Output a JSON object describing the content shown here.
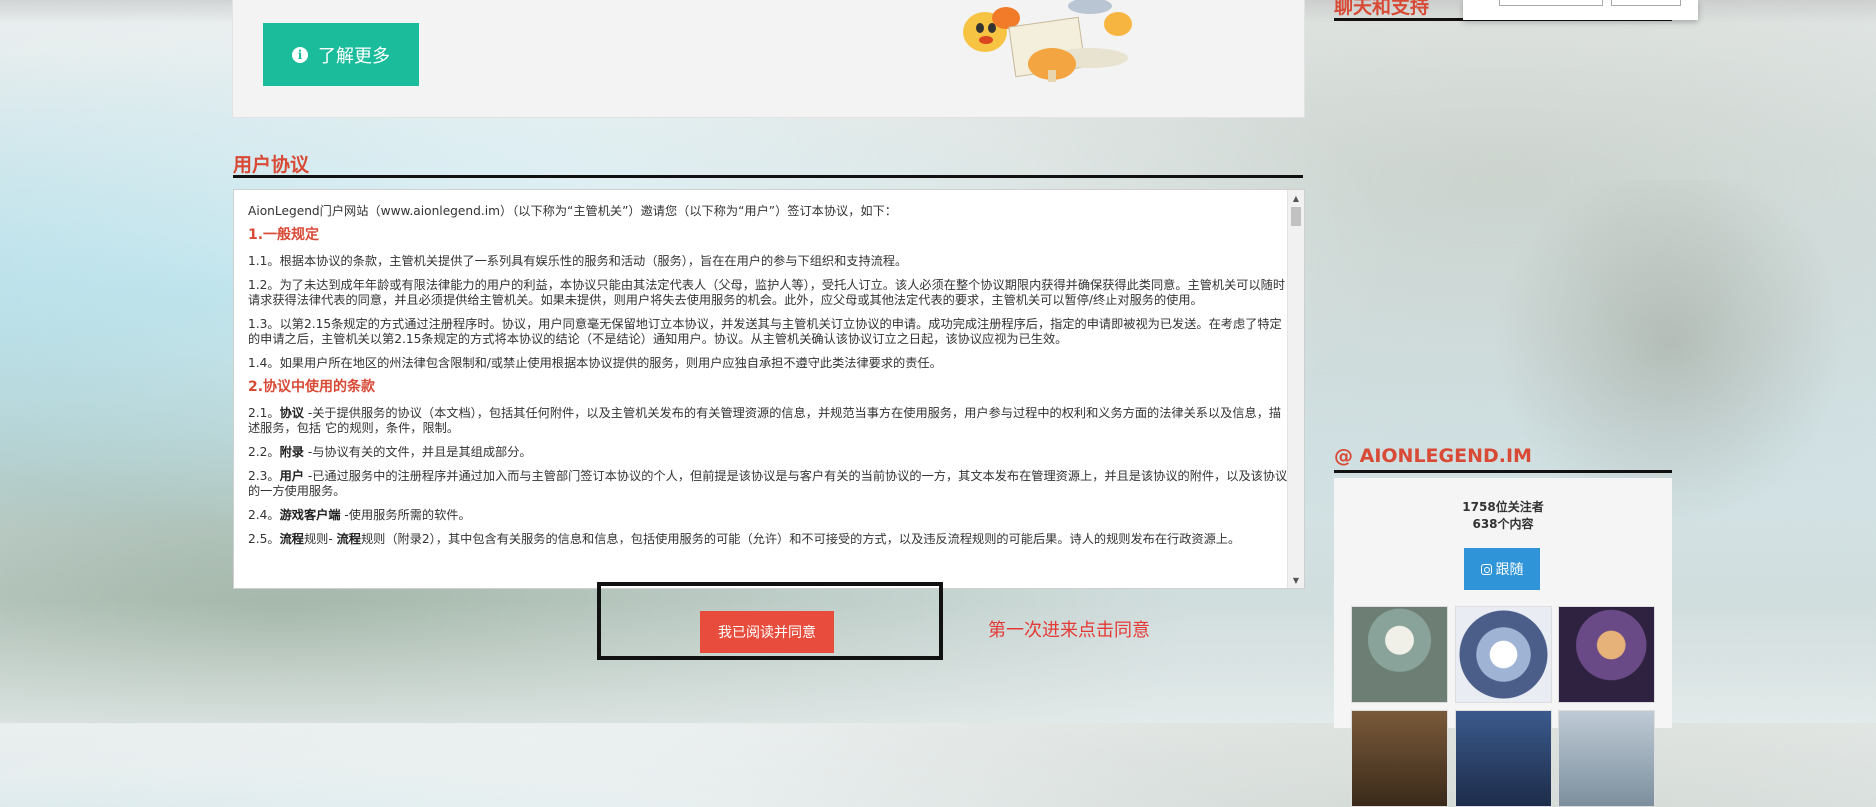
{
  "info_box": {
    "more_button_label": "了解更多"
  },
  "agreement": {
    "title": "用户协议",
    "intro": "AionLegend门户网站（www.aionlegend.im）（以下称为“主管机关”）邀请您（以下称为“用户”）签订本协议，如下：",
    "section1_heading": "1.一般规定",
    "s1_1": "1.1。根据本协议的条款，主管机关提供了一系列具有娱乐性的服务和活动（服务），旨在在用户的参与下组织和支持流程。",
    "s1_2": "1.2。为了未达到成年年龄或有限法律能力的用户的利益，本协议只能由其法定代表人（父母，监护人等），受托人订立。该人必须在整个协议期限内获得并确保获得此类同意。主管机关可以随时请求获得法律代表的同意，并且必须提供给主管机关。如果未提供，则用户将失去使用服务的机会。此外，应父母或其他法定代表的要求，主管机关可以暂停/终止对服务的使用。",
    "s1_3": "1.3。以第2.15条规定的方式通过注册程序时。协议，用户同意毫无保留地订立本协议，并发送其与主管机关订立协议的申请。成功完成注册程序后，指定的申请即被视为已发送。在考虑了特定的申请之后，主管机关以第2.15条规定的方式将本协议的结论（不是结论）通知用户。协议。从主管机关确认该协议订立之日起，该协议应视为已生效。",
    "s1_4": "1.4。如果用户所在地区的州法律包含限制和/或禁止使用根据本协议提供的服务，则用户应独自承担不遵守此类法律要求的责任。",
    "section2_heading": "2.协议中使用的条款",
    "s2_1_num": "2.1。",
    "s2_1_term": "协议",
    "s2_1_text": " -关于提供服务的协议（本文档），包括其任何附件，以及主管机关发布的有关管理资源的信息，并规范当事方在使用服务，用户参与过程中的权利和义务方面的法律关系以及信息，描述服务，包括 它的规则，条件，限制。",
    "s2_2_num": "2.2。",
    "s2_2_term": "附录",
    "s2_2_text": " -与协议有关的文件，并且是其组成部分。",
    "s2_3_num": "2.3。",
    "s2_3_term": "用户",
    "s2_3_text": " -已通过服务中的注册程序并通过加入而与主管部门签订本协议的个人，但前提是该协议是与客户有关的当前协议的一方，其文本发布在管理资源上，并且是该协议的附件，以及该协议的一方使用服务。",
    "s2_4_num": "2.4。",
    "s2_4_term": "游戏客户端",
    "s2_4_text": " -使用服务所需的软件。",
    "s2_5_num": "2.5。",
    "s2_5_term": "流程",
    "s2_5_text_a": "规则- ",
    "s2_5_term2": "流程",
    "s2_5_text_b": "规则（附录2），其中包含有关服务的信息和信息，包括使用服务的可能（允许）和不可接受的方式，以及违反流程规则的可能后果。诗人的规则发布在行政资源上。",
    "agree_button_label": "我已阅读并同意",
    "note": "第一次进来点击同意"
  },
  "sidebar": {
    "chat_title": "聊天和支持",
    "instagram_title": "@ AIONLEGEND.IM",
    "followers": "1758位关注者",
    "posts": "638个内容",
    "follow_label": "跟随"
  }
}
